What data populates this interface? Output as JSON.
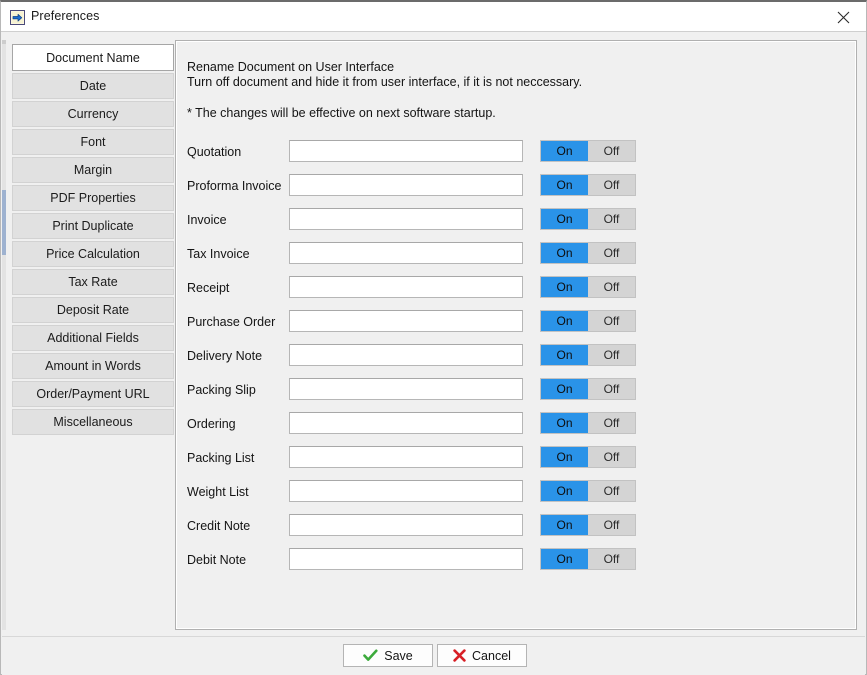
{
  "window": {
    "title": "Preferences",
    "title_icon": "import-document-icon",
    "close_icon": "close-icon"
  },
  "sidebar": {
    "items": [
      {
        "label": "Document Name",
        "selected": true
      },
      {
        "label": "Date",
        "selected": false
      },
      {
        "label": "Currency",
        "selected": false
      },
      {
        "label": "Font",
        "selected": false
      },
      {
        "label": "Margin",
        "selected": false
      },
      {
        "label": "PDF Properties",
        "selected": false
      },
      {
        "label": "Print Duplicate",
        "selected": false
      },
      {
        "label": "Price Calculation",
        "selected": false
      },
      {
        "label": "Tax Rate",
        "selected": false
      },
      {
        "label": "Deposit Rate",
        "selected": false
      },
      {
        "label": "Additional Fields",
        "selected": false
      },
      {
        "label": "Amount in Words",
        "selected": false
      },
      {
        "label": "Order/Payment URL",
        "selected": false
      },
      {
        "label": "Miscellaneous",
        "selected": false
      }
    ]
  },
  "main": {
    "heading_line1": "Rename Document on User Interface",
    "heading_line2": "Turn off document and hide it from user interface, if it is not neccessary.",
    "heading_note": "* The changes will be effective on next software startup.",
    "toggle_on_label": "On",
    "toggle_off_label": "Off",
    "input_placeholder": "",
    "rows": [
      {
        "label": "Quotation",
        "value": "",
        "state": "On"
      },
      {
        "label": "Proforma Invoice",
        "value": "",
        "state": "On"
      },
      {
        "label": "Invoice",
        "value": "",
        "state": "On"
      },
      {
        "label": "Tax Invoice",
        "value": "",
        "state": "On"
      },
      {
        "label": "Receipt",
        "value": "",
        "state": "On"
      },
      {
        "label": "Purchase Order",
        "value": "",
        "state": "On"
      },
      {
        "label": "Delivery Note",
        "value": "",
        "state": "On"
      },
      {
        "label": "Packing Slip",
        "value": "",
        "state": "On"
      },
      {
        "label": "Ordering",
        "value": "",
        "state": "On"
      },
      {
        "label": "Packing List",
        "value": "",
        "state": "On"
      },
      {
        "label": "Weight List",
        "value": "",
        "state": "On"
      },
      {
        "label": "Credit Note",
        "value": "",
        "state": "On"
      },
      {
        "label": "Debit Note",
        "value": "",
        "state": "On"
      }
    ]
  },
  "footer": {
    "save_label": "Save",
    "save_icon": "check-icon",
    "cancel_label": "Cancel",
    "cancel_icon": "cross-icon"
  },
  "colors": {
    "toggle_on_bg": "#2a93e8",
    "toggle_off_bg": "#d4d4d4",
    "save_check": "#3caa3c",
    "cancel_cross": "#d81f26",
    "window_bg": "#f0f0f0",
    "tab_bg": "#e1e1e1",
    "tab_selected_bg": "#ffffff"
  }
}
